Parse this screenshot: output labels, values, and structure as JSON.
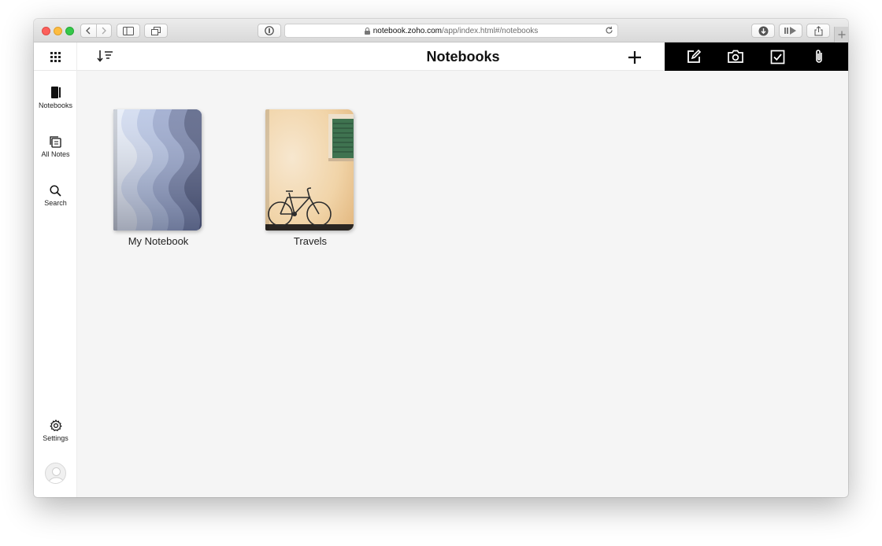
{
  "browser": {
    "url_domain": "notebook.zoho.com",
    "url_path": "/app/index.html#/notebooks"
  },
  "header": {
    "title": "Notebooks"
  },
  "sidebar": {
    "items": [
      {
        "label": "Notebooks",
        "icon": "notebook-icon"
      },
      {
        "label": "All Notes",
        "icon": "notes-stack-icon"
      },
      {
        "label": "Search",
        "icon": "search-icon"
      }
    ],
    "settings_label": "Settings"
  },
  "create_bar": {
    "icons": [
      "edit-note-icon",
      "camera-icon",
      "checklist-icon",
      "attachment-icon"
    ]
  },
  "notebooks": [
    {
      "title": "My Notebook",
      "cover": "blue-waves"
    },
    {
      "title": "Travels",
      "cover": "bicycle-wall"
    }
  ],
  "colors": {
    "create_bar_bg": "#000000",
    "content_bg": "#f5f5f5",
    "sidebar_bg": "#ffffff"
  }
}
